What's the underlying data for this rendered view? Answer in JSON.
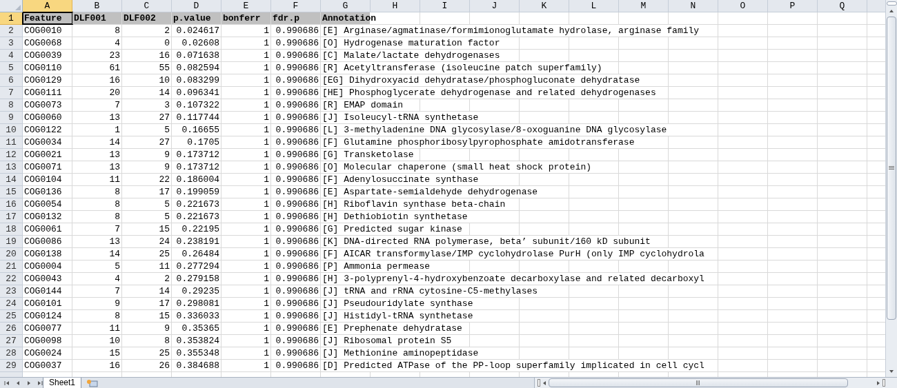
{
  "columns": [
    {
      "letter": "A",
      "selected": true
    },
    {
      "letter": "B",
      "selected": false
    },
    {
      "letter": "C",
      "selected": false
    },
    {
      "letter": "D",
      "selected": false
    },
    {
      "letter": "E",
      "selected": false
    },
    {
      "letter": "F",
      "selected": false
    },
    {
      "letter": "G",
      "selected": false
    },
    {
      "letter": "H",
      "selected": false
    },
    {
      "letter": "I",
      "selected": false
    },
    {
      "letter": "J",
      "selected": false
    },
    {
      "letter": "K",
      "selected": false
    },
    {
      "letter": "L",
      "selected": false
    },
    {
      "letter": "M",
      "selected": false
    },
    {
      "letter": "N",
      "selected": false
    },
    {
      "letter": "O",
      "selected": false
    },
    {
      "letter": "P",
      "selected": false
    },
    {
      "letter": "Q",
      "selected": false
    }
  ],
  "header_row": {
    "number": "1",
    "selected": true,
    "cells": [
      {
        "text": "Feature",
        "selected": true
      },
      {
        "text": "DLF001",
        "selected": false
      },
      {
        "text": "DLF002",
        "selected": false
      },
      {
        "text": "p.value",
        "selected": false
      },
      {
        "text": "bonferr",
        "selected": false
      },
      {
        "text": "fdr.p",
        "selected": false
      },
      {
        "text": "Annotation",
        "selected": false
      }
    ]
  },
  "rows": [
    {
      "number": "2",
      "cells": [
        "COG0010",
        "8",
        "2",
        "0.024617",
        "1",
        "0.990686",
        "[E] Arginase/agmatinase/formimionoglutamate hydrolase, arginase family"
      ]
    },
    {
      "number": "3",
      "cells": [
        "COG0068",
        "4",
        "0",
        "0.02608",
        "1",
        "0.990686",
        "[O] Hydrogenase maturation factor"
      ]
    },
    {
      "number": "4",
      "cells": [
        "COG0039",
        "23",
        "16",
        "0.071638",
        "1",
        "0.990686",
        "[C] Malate/lactate dehydrogenases"
      ]
    },
    {
      "number": "5",
      "cells": [
        "COG0110",
        "61",
        "55",
        "0.082594",
        "1",
        "0.990686",
        "[R] Acetyltransferase (isoleucine patch superfamily)"
      ]
    },
    {
      "number": "6",
      "cells": [
        "COG0129",
        "16",
        "10",
        "0.083299",
        "1",
        "0.990686",
        "[EG] Dihydroxyacid dehydratase/phosphogluconate dehydratase"
      ]
    },
    {
      "number": "7",
      "cells": [
        "COG0111",
        "20",
        "14",
        "0.096341",
        "1",
        "0.990686",
        "[HE] Phosphoglycerate dehydrogenase and related dehydrogenases"
      ]
    },
    {
      "number": "8",
      "cells": [
        "COG0073",
        "7",
        "3",
        "0.107322",
        "1",
        "0.990686",
        "[R] EMAP domain"
      ]
    },
    {
      "number": "9",
      "cells": [
        "COG0060",
        "13",
        "27",
        "0.117744",
        "1",
        "0.990686",
        "[J] Isoleucyl-tRNA synthetase"
      ]
    },
    {
      "number": "10",
      "cells": [
        "COG0122",
        "1",
        "5",
        "0.16655",
        "1",
        "0.990686",
        "[L] 3-methyladenine DNA glycosylase/8-oxoguanine DNA glycosylase"
      ]
    },
    {
      "number": "11",
      "cells": [
        "COG0034",
        "14",
        "27",
        "0.1705",
        "1",
        "0.990686",
        "[F] Glutamine phosphoribosylpyrophosphate amidotransferase"
      ]
    },
    {
      "number": "12",
      "cells": [
        "COG0021",
        "13",
        "9",
        "0.173712",
        "1",
        "0.990686",
        "[G] Transketolase"
      ]
    },
    {
      "number": "13",
      "cells": [
        "COG0071",
        "13",
        "9",
        "0.173712",
        "1",
        "0.990686",
        "[O] Molecular chaperone (small heat shock protein)"
      ]
    },
    {
      "number": "14",
      "cells": [
        "COG0104",
        "11",
        "22",
        "0.186004",
        "1",
        "0.990686",
        "[F] Adenylosuccinate synthase"
      ]
    },
    {
      "number": "15",
      "cells": [
        "COG0136",
        "8",
        "17",
        "0.199059",
        "1",
        "0.990686",
        "[E] Aspartate-semialdehyde dehydrogenase"
      ]
    },
    {
      "number": "16",
      "cells": [
        "COG0054",
        "8",
        "5",
        "0.221673",
        "1",
        "0.990686",
        "[H] Riboflavin synthase beta-chain"
      ]
    },
    {
      "number": "17",
      "cells": [
        "COG0132",
        "8",
        "5",
        "0.221673",
        "1",
        "0.990686",
        "[H] Dethiobiotin synthetase"
      ]
    },
    {
      "number": "18",
      "cells": [
        "COG0061",
        "7",
        "15",
        "0.22195",
        "1",
        "0.990686",
        "[G] Predicted sugar kinase"
      ]
    },
    {
      "number": "19",
      "cells": [
        "COG0086",
        "13",
        "24",
        "0.238191",
        "1",
        "0.990686",
        "[K] DNA-directed RNA polymerase, beta’ subunit/160 kD subunit"
      ]
    },
    {
      "number": "20",
      "cells": [
        "COG0138",
        "14",
        "25",
        "0.26484",
        "1",
        "0.990686",
        "[F] AICAR transformylase/IMP cyclohydrolase PurH (only IMP cyclohydrola"
      ]
    },
    {
      "number": "21",
      "cells": [
        "COG0004",
        "5",
        "11",
        "0.277294",
        "1",
        "0.990686",
        "[P] Ammonia permease"
      ]
    },
    {
      "number": "22",
      "cells": [
        "COG0043",
        "4",
        "2",
        "0.279158",
        "1",
        "0.990686",
        "[H] 3-polyprenyl-4-hydroxybenzoate decarboxylase and related decarboxyl"
      ]
    },
    {
      "number": "23",
      "cells": [
        "COG0144",
        "7",
        "14",
        "0.29235",
        "1",
        "0.990686",
        "[J] tRNA and rRNA cytosine-C5-methylases"
      ]
    },
    {
      "number": "24",
      "cells": [
        "COG0101",
        "9",
        "17",
        "0.298081",
        "1",
        "0.990686",
        "[J] Pseudouridylate synthase"
      ]
    },
    {
      "number": "25",
      "cells": [
        "COG0124",
        "8",
        "15",
        "0.336033",
        "1",
        "0.990686",
        "[J] Histidyl-tRNA synthetase"
      ]
    },
    {
      "number": "26",
      "cells": [
        "COG0077",
        "11",
        "9",
        "0.35365",
        "1",
        "0.990686",
        "[E] Prephenate dehydratase"
      ]
    },
    {
      "number": "27",
      "cells": [
        "COG0098",
        "10",
        "8",
        "0.353824",
        "1",
        "0.990686",
        "[J] Ribosomal protein S5"
      ]
    },
    {
      "number": "28",
      "cells": [
        "COG0024",
        "15",
        "25",
        "0.355348",
        "1",
        "0.990686",
        "[J] Methionine aminopeptidase"
      ]
    },
    {
      "number": "29",
      "cells": [
        "COG0037",
        "16",
        "26",
        "0.384688",
        "1",
        "0.990686",
        "[D] Predicted ATPase of the PP-loop superfamily implicated in cell cycl"
      ]
    }
  ],
  "sheet_tabs": [
    {
      "label": "Sheet1",
      "selected": true
    }
  ]
}
